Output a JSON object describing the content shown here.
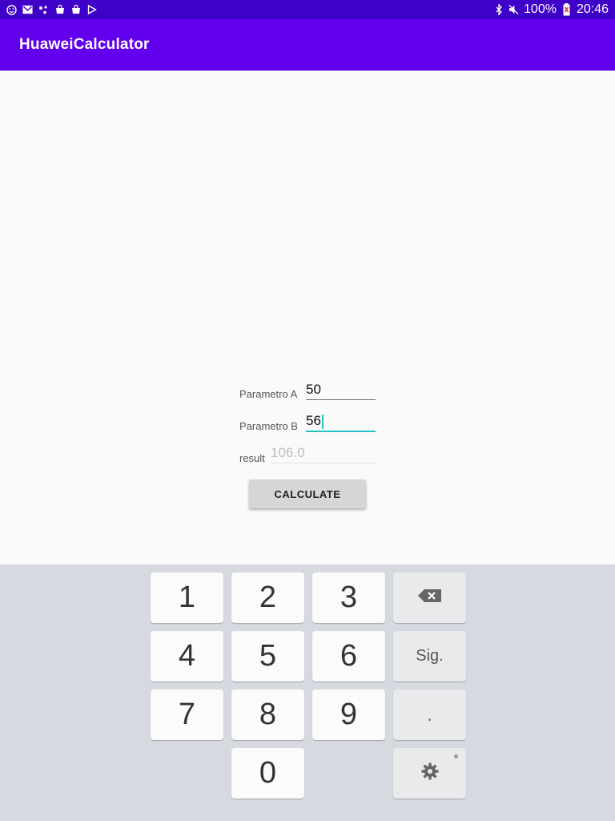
{
  "status_bar": {
    "battery": "100%",
    "time": "20:46",
    "left_icons": [
      "emoji-icon",
      "mail-icon",
      "dots-icon",
      "bag-icon",
      "bag-icon",
      "play-icon"
    ],
    "right_icons": [
      "bluetooth-icon",
      "mute-icon",
      "battery-icon"
    ]
  },
  "app_bar": {
    "title": "HuaweiCalculator"
  },
  "form": {
    "param_a_label": "Parametro A",
    "param_a_value": "50",
    "param_b_label": "Parametro B",
    "param_b_value": "56",
    "result_label": "result",
    "result_value": "106.0",
    "calculate_label": "CALCULATE"
  },
  "keyboard": {
    "keys": [
      "1",
      "2",
      "3",
      "4",
      "5",
      "6",
      "7",
      "8",
      "9",
      "0"
    ],
    "sign_label": "Sig.",
    "dot_label": ".",
    "backspace_icon": "backspace-icon",
    "settings_icon": "gear-icon"
  },
  "colors": {
    "status_bar": "#3f00c7",
    "app_bar": "#6200ee",
    "accent": "#26c2c2",
    "keyboard_bg": "#d6d9df"
  }
}
